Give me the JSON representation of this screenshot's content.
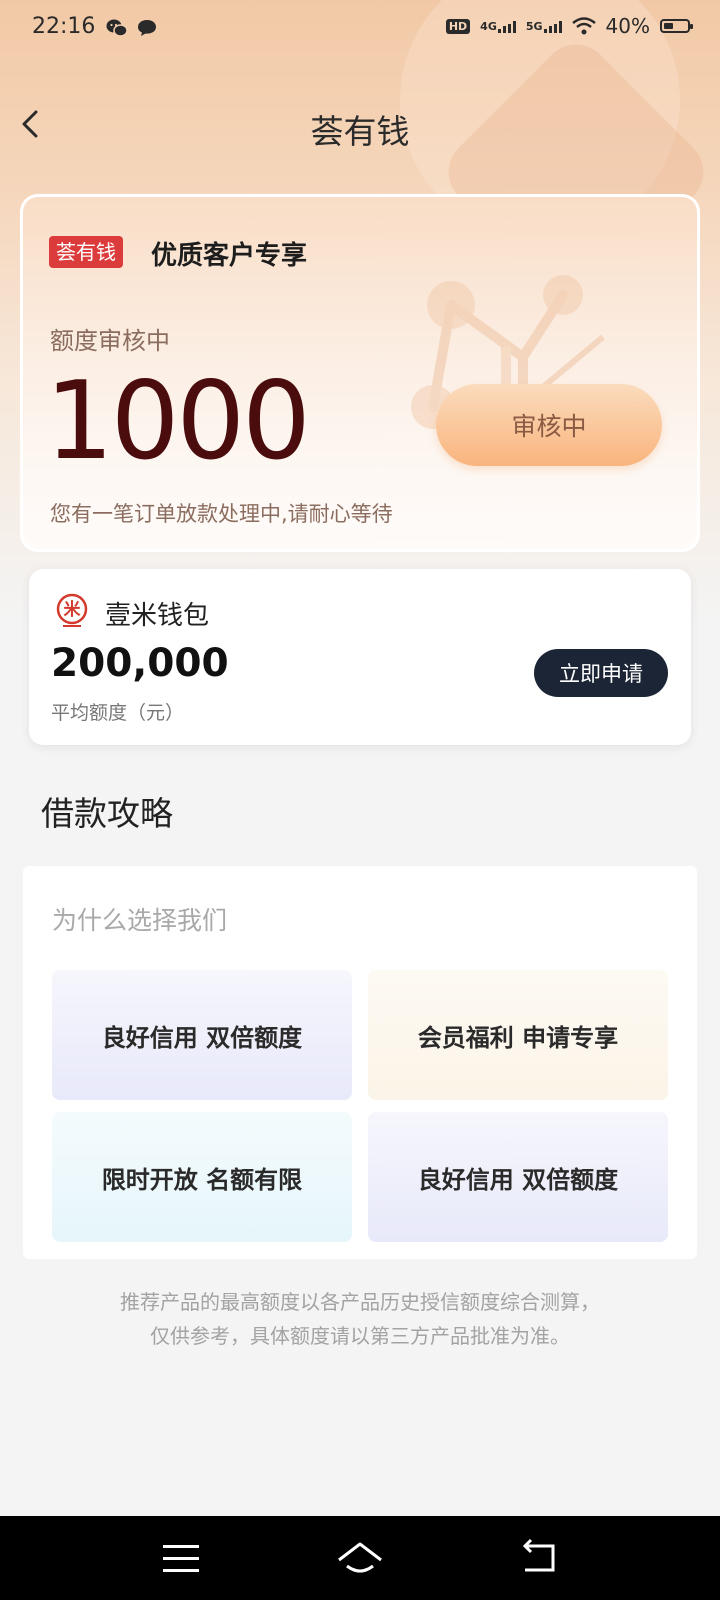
{
  "status_bar": {
    "time": "22:16",
    "network_1": "4G",
    "network_2": "5G",
    "hd": "HD",
    "battery_percent_text": "40%",
    "battery_level": 0.4
  },
  "nav": {
    "title": "荟有钱"
  },
  "main_card": {
    "brand_tag": "荟有钱",
    "heading": "优质客户专享",
    "quota_label": "额度审核中",
    "quota_amount": "1000",
    "review_button": "审核中",
    "notice": "您有一笔订单放款处理中,请耐心等待"
  },
  "product": {
    "name": "壹米钱包",
    "amount": "200,000",
    "amount_label": "平均额度（元）",
    "apply_button": "立即申请",
    "logo_char": "米"
  },
  "guide": {
    "title": "借款攻略",
    "subtitle": "为什么选择我们",
    "features": [
      "良好信用 双倍额度",
      "会员福利 申请专享",
      "限时开放 名额有限",
      "良好信用 双倍额度"
    ]
  },
  "disclaimer": {
    "line1": "推荐产品的最高额度以各产品历史授信额度综合测算，",
    "line2": "仅供参考，具体额度请以第三方产品批准为准。"
  },
  "colors": {
    "brand_red": "#dc3b3b",
    "amount_dark_red": "#4a0c0c",
    "apply_button_bg": "#1b2535",
    "review_button_orange": "#f9b47d"
  }
}
